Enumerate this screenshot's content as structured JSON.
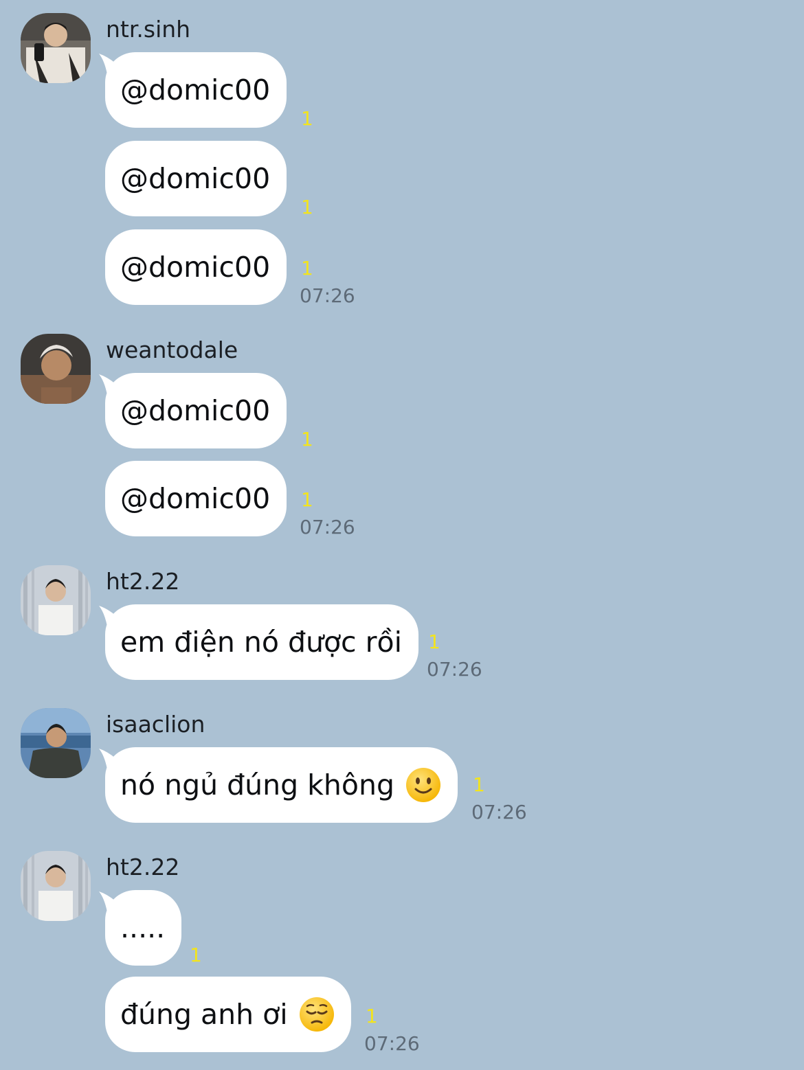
{
  "messages_view": {
    "groups": [
      {
        "sender": "ntr.sinh",
        "messages": [
          {
            "text": "@domic00",
            "unread": "1",
            "time": ""
          },
          {
            "text": "@domic00",
            "unread": "1",
            "time": ""
          },
          {
            "text": "@domic00",
            "unread": "1",
            "time": "07:26"
          }
        ]
      },
      {
        "sender": "weantodale",
        "messages": [
          {
            "text": "@domic00",
            "unread": "1",
            "time": ""
          },
          {
            "text": "@domic00",
            "unread": "1",
            "time": "07:26"
          }
        ]
      },
      {
        "sender": "ht2.22",
        "messages": [
          {
            "text": "em điện nó được rồi",
            "unread": "1",
            "time": "07:26"
          }
        ]
      },
      {
        "sender": "isaaclion",
        "messages": [
          {
            "text": "nó ngủ đúng không",
            "emoji": "slightly-smiling-face",
            "unread": "1",
            "time": "07:26"
          }
        ]
      },
      {
        "sender": "ht2.22",
        "messages": [
          {
            "text": ".....",
            "unread": "1",
            "time": ""
          },
          {
            "text": "đúng anh ơi",
            "emoji": "pensive-face",
            "unread": "1",
            "time": "07:26"
          }
        ]
      }
    ]
  },
  "colors": {
    "background": "#abc1d3",
    "bubble": "#ffffff",
    "unread_count": "#f3e41c",
    "timestamp": "#5d6a77"
  }
}
